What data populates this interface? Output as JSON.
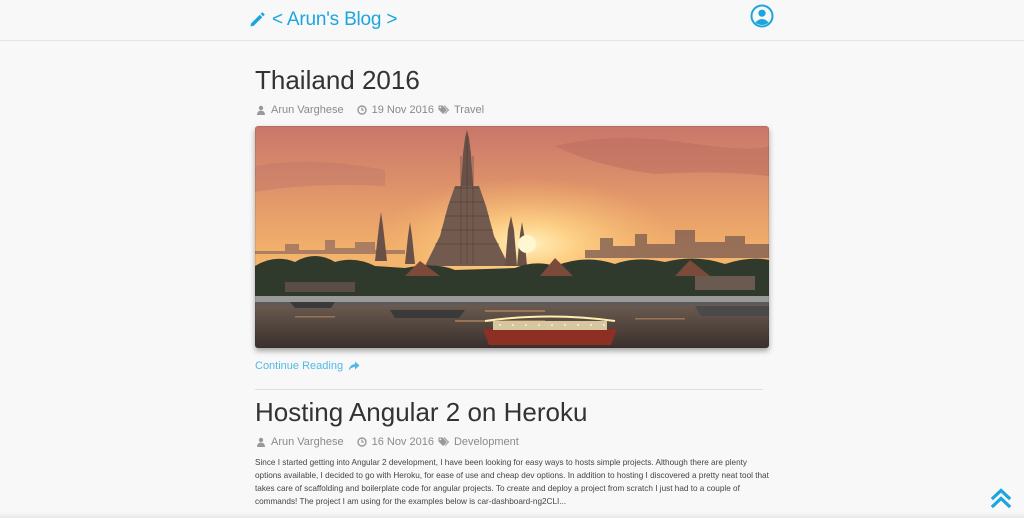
{
  "header": {
    "brand_label": "< Arun's Blog >",
    "brand_icon": "pencil-icon",
    "account_icon": "user-circle-icon",
    "accent_color": "#1ca6dd"
  },
  "posts": [
    {
      "title": "Thailand 2016",
      "author": "Arun Varghese",
      "date": "19 Nov 2016",
      "category": "Travel",
      "continue_label": "Continue Reading"
    },
    {
      "title": "Hosting Angular 2 on Heroku",
      "author": "Arun Varghese",
      "date": "16 Nov 2016",
      "category": "Development",
      "excerpt": "Since I started getting into Angular 2 development, I have been looking for easy ways to hosts simple projects. Although there are plenty options available, I decided to go with Heroku, for ease of use and cheap dev options. In addition to hosting I discovered a pretty neat tool that takes care of scaffolding and boilerplate code for angular projects. To create and deploy a project from scratch I just had to a couple of commands! The project I am using for the examples below is car-dashboard-ng2CLI..."
    }
  ],
  "back_to_top_icon": "double-chevron-up-icon"
}
